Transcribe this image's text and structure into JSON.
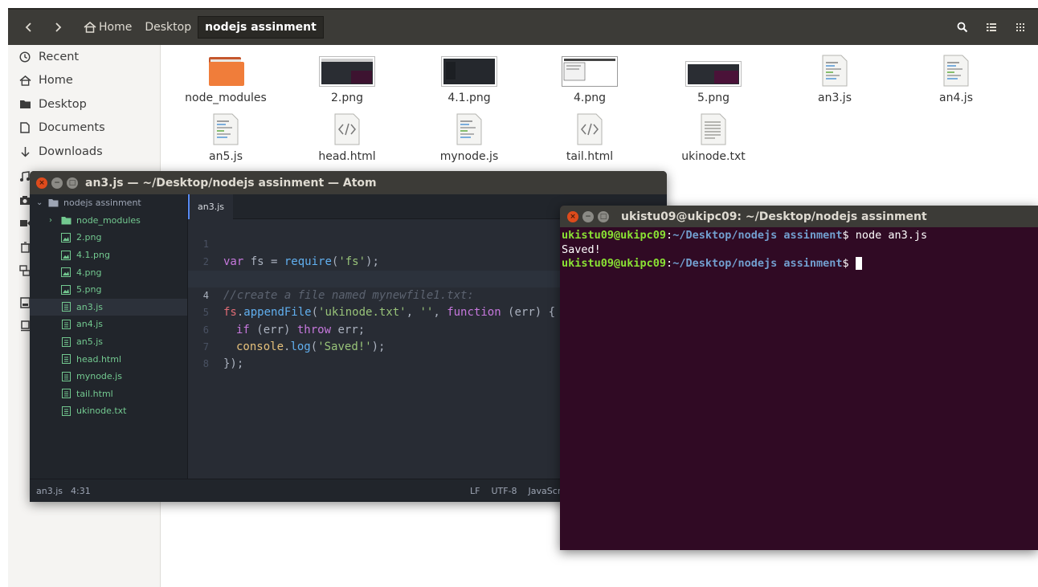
{
  "files_window": {
    "path": [
      "Home",
      "Desktop",
      "nodejs assinment"
    ],
    "sidebar": [
      "Recent",
      "Home",
      "Desktop",
      "Documents",
      "Downloads"
    ],
    "files_row1": [
      {
        "name": "node_modules",
        "kind": "folder"
      },
      {
        "name": "2.png",
        "kind": "image"
      },
      {
        "name": "4.1.png",
        "kind": "image"
      },
      {
        "name": "4.png",
        "kind": "image"
      },
      {
        "name": "5.png",
        "kind": "image"
      },
      {
        "name": "an3.js",
        "kind": "script"
      },
      {
        "name": "an4.js",
        "kind": "script"
      }
    ],
    "files_row2": [
      {
        "name": "an5.js",
        "kind": "script"
      },
      {
        "name": "head.html",
        "kind": "html"
      },
      {
        "name": "mynode.js",
        "kind": "script"
      },
      {
        "name": "tail.html",
        "kind": "html"
      },
      {
        "name": "ukinode.txt",
        "kind": "text"
      }
    ]
  },
  "atom": {
    "title": "an3.js — ~/Desktop/nodejs assinment — Atom",
    "tree_root": "nodejs assinment",
    "tree_items": [
      "node_modules",
      "2.png",
      "4.1.png",
      "4.png",
      "5.png",
      "an3.js",
      "an4.js",
      "an5.js",
      "head.html",
      "mynode.js",
      "tail.html",
      "ukinode.txt"
    ],
    "tab": "an3.js",
    "line_numbers": [
      "1",
      "2",
      "3",
      "4",
      "5",
      "6",
      "7",
      "8"
    ],
    "code": {
      "l1_kw": "var",
      "l1_a": " fs = ",
      "l1_fn": "require",
      "l1_b": "(",
      "l1_str": "'fs'",
      "l1_c": ");",
      "l3": "//create a file named mynewfile1.txt:",
      "l4_obj": "fs",
      "l4_a": ".",
      "l4_fn": "appendFile",
      "l4_b": "(",
      "l4_str1": "'ukinode.txt'",
      "l4_c": ", ",
      "l4_str2": "''",
      "l4_d": ", ",
      "l4_kw": "function",
      "l4_e": " (err) {",
      "l5_kw1": "if",
      "l5_a": " (err) ",
      "l5_kw2": "throw",
      "l5_b": " err;",
      "l6_obj": "console",
      "l6_a": ".",
      "l6_fn": "log",
      "l6_b": "(",
      "l6_str": "'Saved!'",
      "l6_c": ");",
      "l7": "});"
    },
    "status": {
      "file": "an3.js",
      "position": "4:31",
      "line_ending": "LF",
      "encoding": "UTF-8",
      "grammar": "JavaScri"
    }
  },
  "terminal": {
    "title": "ukistu09@ukipc09: ~/Desktop/nodejs assinment",
    "user": "ukistu09@ukipc09",
    "colon": ":",
    "path": "~/Desktop/nodejs assinment",
    "dollar": "$",
    "command": " node an3.js",
    "output": "Saved!"
  }
}
